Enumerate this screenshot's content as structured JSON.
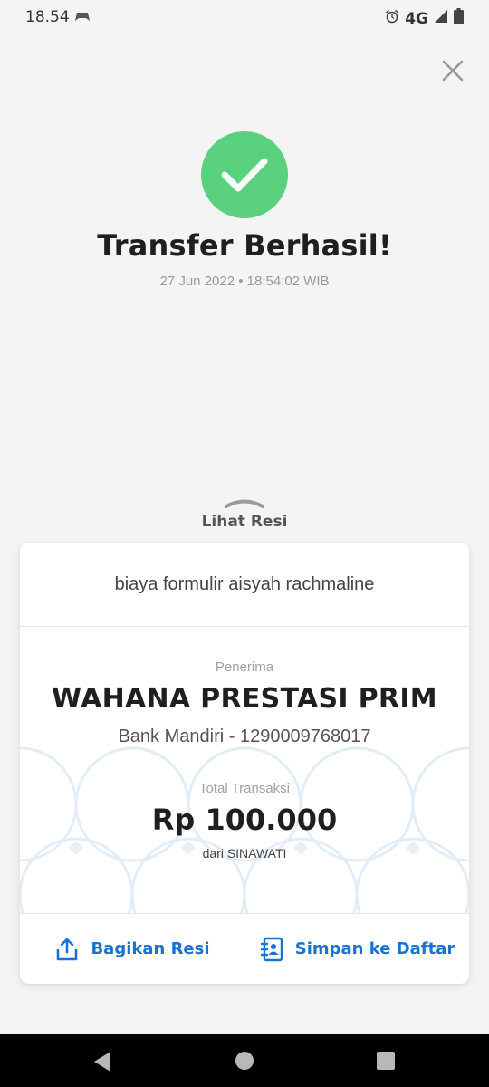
{
  "status_bar": {
    "time": "18.54",
    "network": "4G"
  },
  "header": {
    "title": "Transfer Berhasil!",
    "datetime": "27 Jun 2022 • 18:54:02 WIB"
  },
  "receipt_toggle": {
    "label": "Lihat Resi"
  },
  "receipt": {
    "note": "biaya formulir aisyah rachmaline",
    "recipient_label": "Penerima",
    "recipient_name": "WAHANA PRESTASI PRIM",
    "recipient_bank": "Bank Mandiri - 1290009768017",
    "total_label": "Total Transaksi",
    "amount": "Rp 100.000",
    "source": "dari SINAWATI"
  },
  "actions": {
    "share_label": "Bagikan Resi",
    "save_label": "Simpan ke Daftar"
  },
  "colors": {
    "success": "#5ad17f",
    "accent": "#1a73d1",
    "background": "#f4f4f4"
  },
  "icons": [
    "gamepad-icon",
    "alarm-icon",
    "signal-icon",
    "battery-icon",
    "close-icon",
    "checkmark-icon",
    "chevron-up-icon",
    "share-icon",
    "contact-book-icon",
    "back-icon",
    "home-icon",
    "recents-icon"
  ]
}
